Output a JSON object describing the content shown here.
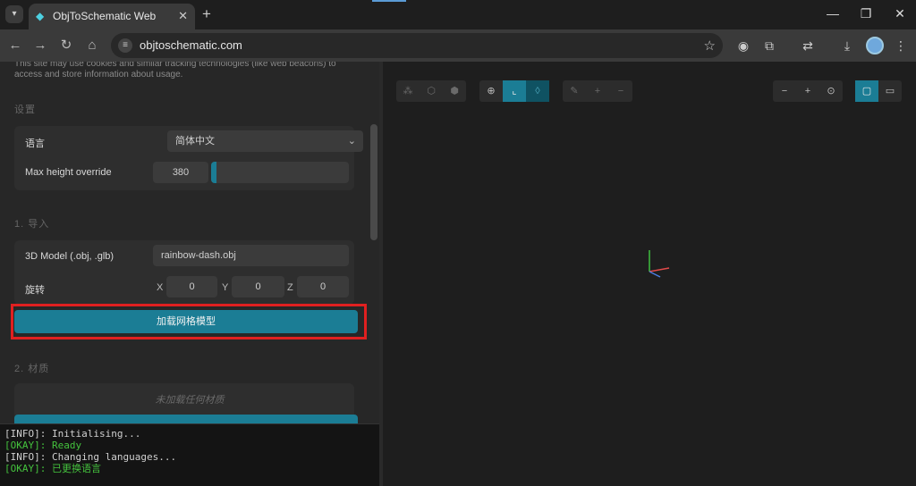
{
  "browser": {
    "tab_title": "ObjToSchematic Web",
    "tab_close": "✕",
    "new_tab": "+",
    "url": "objtoschematic.com",
    "window_controls": {
      "minimize": "—",
      "restore": "❐",
      "close": "✕"
    }
  },
  "notice": "This site may use cookies and similar tracking technologies (like web beacons) to access and store information about usage.",
  "settings": {
    "heading": "设置",
    "language_label": "语言",
    "language_value": "简体中文",
    "max_height_label": "Max height override",
    "max_height_value": "380",
    "max_height_fraction": 0.04
  },
  "import": {
    "heading": "1. 导入",
    "model_label": "3D Model (.obj, .glb)",
    "model_value": "rainbow-dash.obj",
    "rotation_label": "旋转",
    "x_label": "X",
    "x_value": "0",
    "y_label": "Y",
    "y_value": "0",
    "z_label": "Z",
    "z_value": "0",
    "load_button": "加载网格模型"
  },
  "materials": {
    "heading": "2. 材质",
    "empty_message": "未加载任何材质"
  },
  "console": [
    {
      "tag": "[INFO]",
      "text": ": Initialising...",
      "level": "info"
    },
    {
      "tag": "[OKAY]",
      "text": ": Ready",
      "level": "ok"
    },
    {
      "tag": "[INFO]",
      "text": ": Changing languages...",
      "level": "info"
    },
    {
      "tag": "[OKAY]",
      "text": ": 已更换语言",
      "level": "ok"
    }
  ],
  "colors": {
    "accent": "#1b7d95",
    "highlight": "#e02020",
    "ok": "#44c23d"
  }
}
